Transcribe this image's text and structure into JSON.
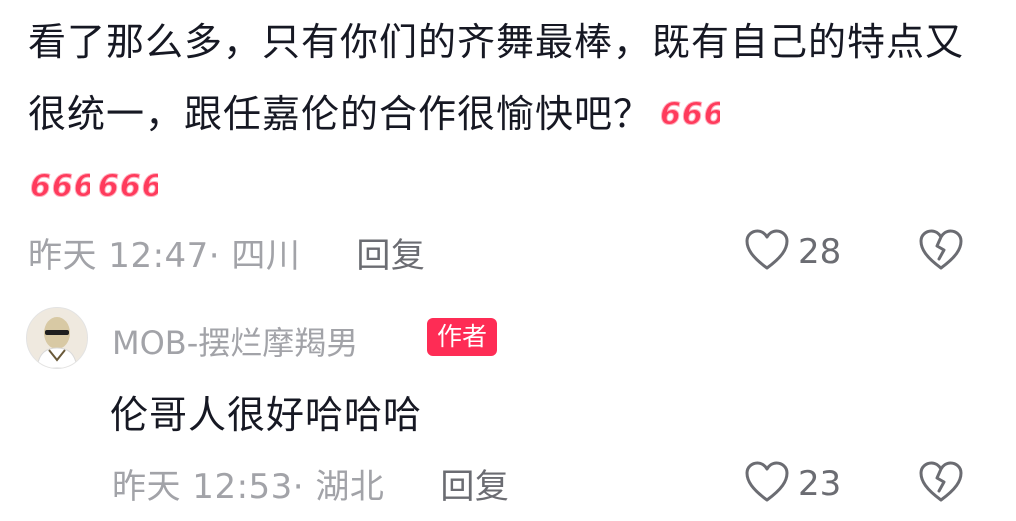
{
  "comment": {
    "text": "看了那么多，只有你们的齐舞最棒，既有自己的特点又很统一，跟任嘉伦的合作很愉快吧？",
    "emoji": "666-sticker",
    "emoji_count": 3,
    "time": "昨天 12:47",
    "location": "四川",
    "reply_label": "回复",
    "like_count": "28"
  },
  "reply": {
    "author": "MOB-摆烂摩羯男",
    "badge": "作者",
    "text": "伦哥人很好哈哈哈",
    "time": "昨天 12:53",
    "location": "湖北",
    "reply_label": "回复",
    "like_count": "23"
  },
  "colors": {
    "text": "#161823",
    "meta": "#a2a3a8",
    "badge": "#fe2c55",
    "emoji": "#ff3b5c"
  }
}
